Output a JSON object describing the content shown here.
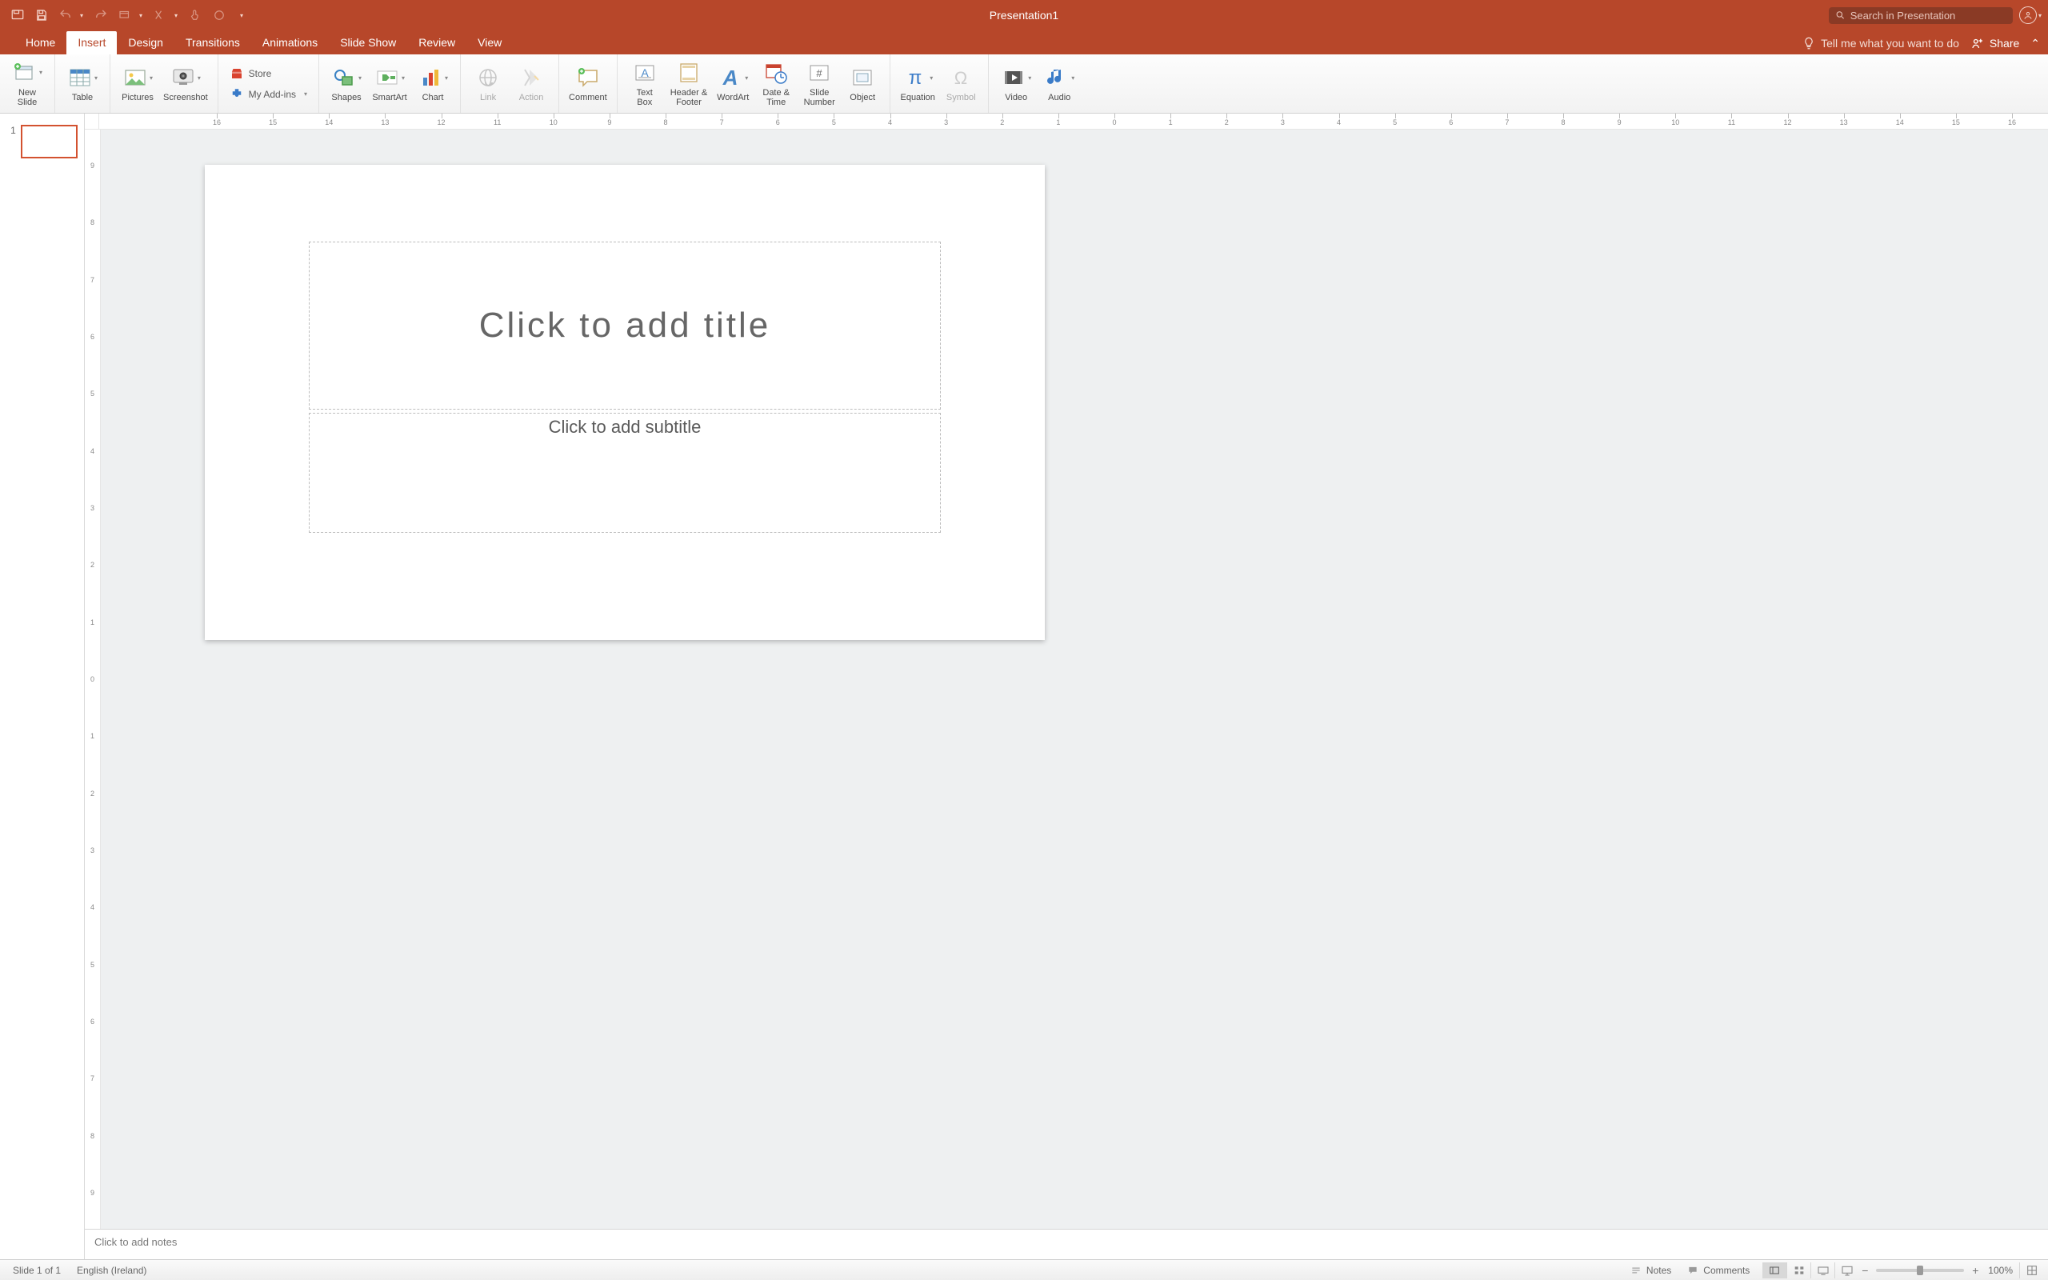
{
  "title": "Presentation1",
  "search": {
    "placeholder": "Search in Presentation"
  },
  "tabs": {
    "items": [
      "Home",
      "Insert",
      "Design",
      "Transitions",
      "Animations",
      "Slide Show",
      "Review",
      "View"
    ],
    "active": "Insert",
    "tellme": "Tell me what you want to do",
    "share": "Share"
  },
  "ribbon": {
    "newslide": "New\nSlide",
    "table": "Table",
    "pictures": "Pictures",
    "screenshot": "Screenshot",
    "store": "Store",
    "myaddins": "My Add-ins",
    "shapes": "Shapes",
    "smartart": "SmartArt",
    "chart": "Chart",
    "link": "Link",
    "action": "Action",
    "comment": "Comment",
    "textbox": "Text\nBox",
    "headerfooter": "Header &\nFooter",
    "wordart": "WordArt",
    "datetime": "Date &\nTime",
    "slidenumber": "Slide\nNumber",
    "object": "Object",
    "equation": "Equation",
    "symbol": "Symbol",
    "video": "Video",
    "audio": "Audio"
  },
  "ruler": {
    "h": [
      "16",
      "15",
      "14",
      "13",
      "12",
      "11",
      "10",
      "9",
      "8",
      "7",
      "6",
      "5",
      "4",
      "3",
      "2",
      "1",
      "0",
      "1",
      "2",
      "3",
      "4",
      "5",
      "6",
      "7",
      "8",
      "9",
      "10",
      "11",
      "12",
      "13",
      "14",
      "15",
      "16"
    ],
    "v": [
      "9",
      "8",
      "7",
      "6",
      "5",
      "4",
      "3",
      "2",
      "1",
      "0",
      "1",
      "2",
      "3",
      "4",
      "5",
      "6",
      "7",
      "8",
      "9"
    ]
  },
  "thumbs": {
    "index": "1"
  },
  "slide": {
    "title_placeholder": "Click to add title",
    "subtitle_placeholder": "Click to add subtitle"
  },
  "notes_placeholder": "Click to add notes",
  "status": {
    "slide_of": "Slide 1 of 1",
    "language": "English (Ireland)",
    "notes": "Notes",
    "comments": "Comments",
    "zoom": "100%"
  }
}
